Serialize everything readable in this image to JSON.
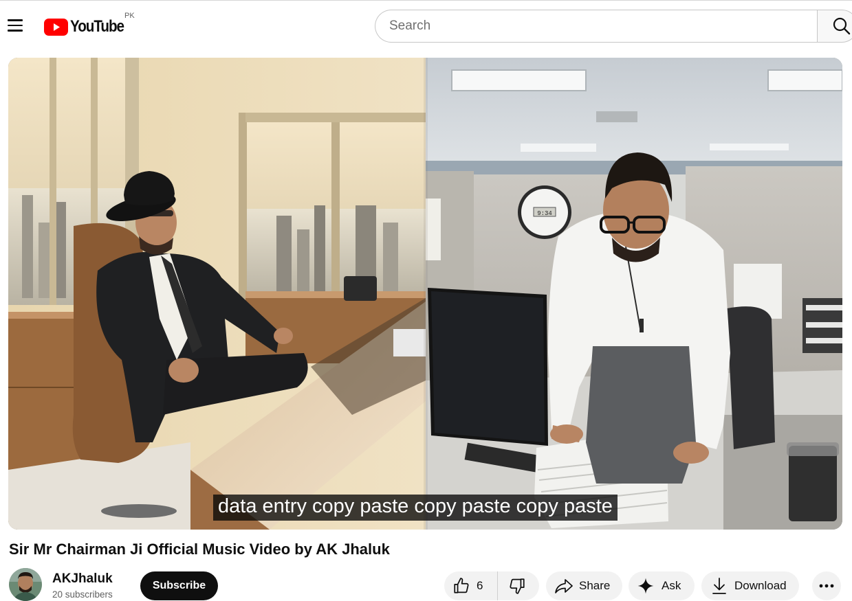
{
  "header": {
    "logo_text": "YouTube",
    "country_code": "PK",
    "search_placeholder": "Search"
  },
  "video": {
    "caption": "data entry copy paste copy paste copy paste",
    "title": "Sir Mr Chairman Ji Official Music Video by AK Jhaluk",
    "clock_display": "9:34"
  },
  "channel": {
    "name": "AKJhaluk",
    "subscribers": "20 subscribers",
    "subscribe_label": "Subscribe"
  },
  "actions": {
    "like_count": "6",
    "share_label": "Share",
    "ask_label": "Ask",
    "download_label": "Download"
  },
  "colors": {
    "brand_red": "#ff0000",
    "text_primary": "#0f0f0f",
    "text_secondary": "#606060",
    "pill_bg": "#f2f2f2"
  }
}
